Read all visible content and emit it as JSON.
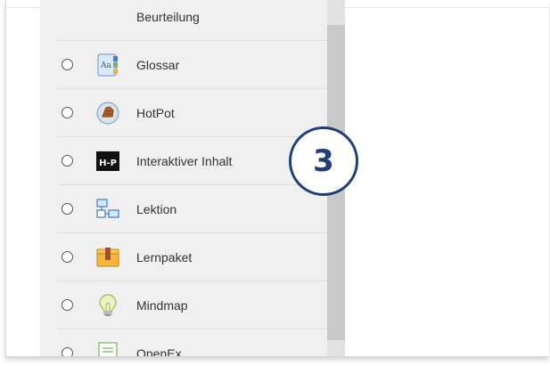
{
  "activity_list": {
    "items": [
      {
        "label": "Beurteilung",
        "icon": "rubric-icon"
      },
      {
        "label": "Glossar",
        "icon": "glossary-icon"
      },
      {
        "label": "HotPot",
        "icon": "hotpot-icon"
      },
      {
        "label": "Interaktiver Inhalt",
        "icon": "h5p-icon",
        "icon_text": "H-P"
      },
      {
        "label": "Lektion",
        "icon": "lesson-icon"
      },
      {
        "label": "Lernpaket",
        "icon": "scorm-package-icon"
      },
      {
        "label": "Mindmap",
        "icon": "lightbulb-icon"
      },
      {
        "label": "OpenEx",
        "icon": "document-icon"
      }
    ]
  },
  "callout": {
    "step_number": "3",
    "color": "#1f3f7a"
  },
  "colors": {
    "panel_bg": "#f0f0f0",
    "text": "#333333",
    "scrollbar_thumb": "#c9c9c9"
  }
}
